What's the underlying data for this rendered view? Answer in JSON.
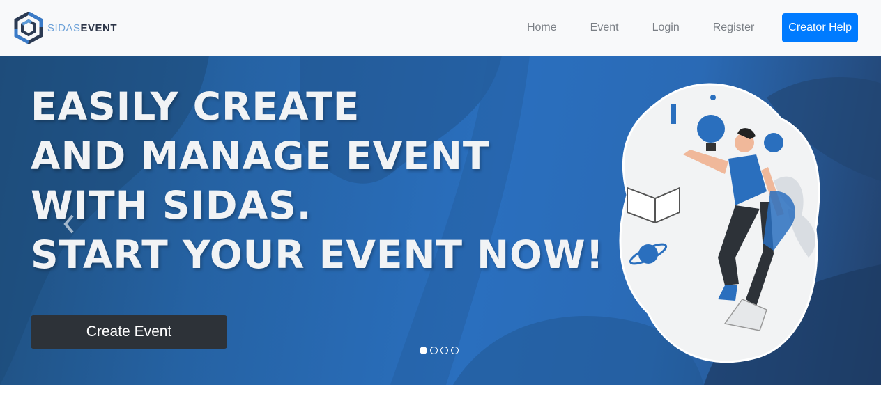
{
  "brand": {
    "name_light": "SIDAS",
    "name_bold": "EVENT",
    "logo_icon": "hexagon-logo-icon"
  },
  "nav": {
    "links": [
      "Home",
      "Event",
      "Login",
      "Register"
    ],
    "cta_label": "Creator Help"
  },
  "hero": {
    "headline": [
      "EASILY CREATE",
      "AND MANAGE EVENT",
      "WITH SIDAS.",
      "START YOUR EVENT NOW!"
    ],
    "button_label": "Create Event",
    "prev_icon": "chevron-left-icon",
    "next_icon": "chevron-right-icon",
    "slide_count": 4,
    "active_slide": 1
  },
  "colors": {
    "primary": "#007bff",
    "hero_blue": "#2a6fbe",
    "dark_button": "#2d3238",
    "navbar_bg": "#f8f9fa"
  }
}
